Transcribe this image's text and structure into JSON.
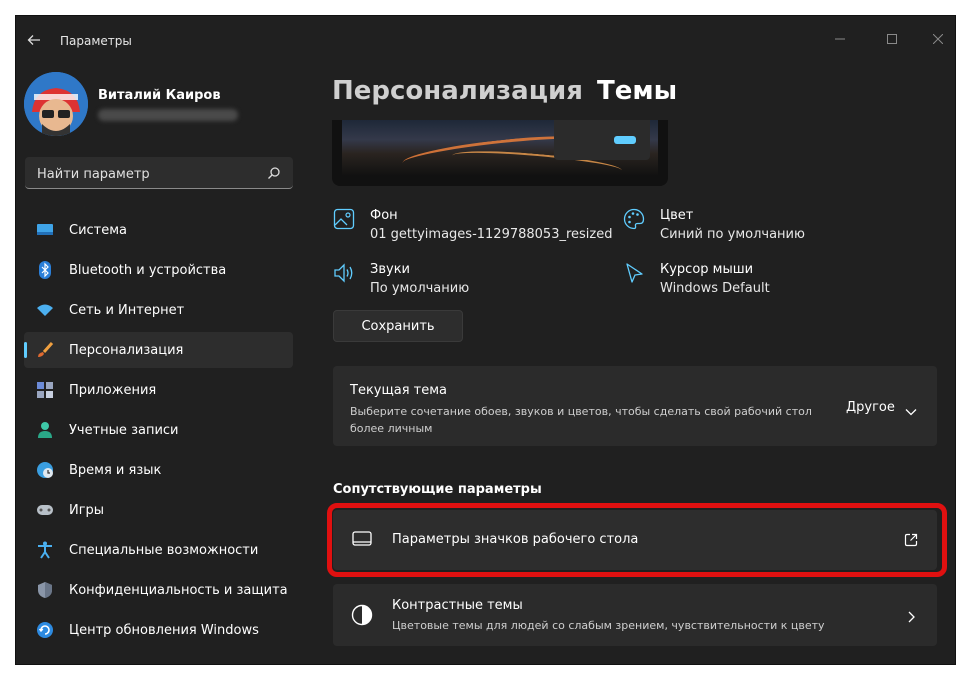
{
  "window": {
    "app_title": "Параметры"
  },
  "profile": {
    "name": "Виталий Каиров"
  },
  "search": {
    "placeholder": "Найти параметр"
  },
  "sidebar": {
    "items": [
      {
        "label": "Система",
        "icon": "display-icon"
      },
      {
        "label": "Bluetooth и устройства",
        "icon": "bluetooth-icon"
      },
      {
        "label": "Сеть и Интернет",
        "icon": "wifi-icon"
      },
      {
        "label": "Персонализация",
        "icon": "brush-icon",
        "active": true
      },
      {
        "label": "Приложения",
        "icon": "apps-icon"
      },
      {
        "label": "Учетные записи",
        "icon": "person-icon"
      },
      {
        "label": "Время и язык",
        "icon": "globe-clock-icon"
      },
      {
        "label": "Игры",
        "icon": "gamepad-icon"
      },
      {
        "label": "Специальные возможности",
        "icon": "accessibility-icon"
      },
      {
        "label": "Конфиденциальность и защита",
        "icon": "shield-icon"
      },
      {
        "label": "Центр обновления Windows",
        "icon": "update-icon"
      }
    ]
  },
  "breadcrumb": {
    "parent": "Персонализация",
    "separator": "›",
    "current": "Темы"
  },
  "theme_props": {
    "background": {
      "title": "Фон",
      "value": "01 gettyimages-1129788053_resized"
    },
    "color": {
      "title": "Цвет",
      "value": "Синий по умолчанию"
    },
    "sounds": {
      "title": "Звуки",
      "value": "По умолчанию"
    },
    "cursor": {
      "title": "Курсор мыши",
      "value": "Windows Default"
    }
  },
  "save_label": "Сохранить",
  "current_theme": {
    "title": "Текущая тема",
    "description": "Выберите сочетание обоев, звуков и цветов, чтобы сделать свой рабочий стол более личным",
    "value": "Другое"
  },
  "related": {
    "header": "Сопутствующие параметры",
    "desktop_icons": {
      "title": "Параметры значков рабочего стола"
    },
    "contrast": {
      "title": "Контрастные темы",
      "description": "Цветовые темы для людей со слабым зрением, чувствительности к цвету"
    }
  },
  "colors": {
    "accent": "#60cdff",
    "window_bg": "#202020",
    "card_bg": "#2b2b2b",
    "highlight": "#e01010"
  }
}
